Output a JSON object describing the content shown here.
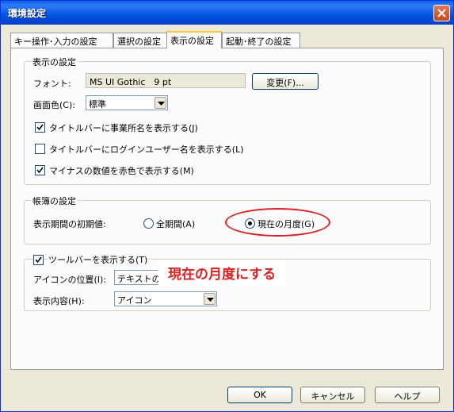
{
  "window": {
    "title": "環境設定"
  },
  "tabs": [
    {
      "label": "キー操作･入力の設定"
    },
    {
      "label": "選択の設定"
    },
    {
      "label": "表示の設定"
    },
    {
      "label": "起動･終了の設定"
    }
  ],
  "active_tab": "表示の設定",
  "display_group": {
    "title": "表示の設定",
    "font_label": "フォント:",
    "font_value": "MS UI Gothic　9 pt",
    "change_button": "変更(F)...",
    "screen_color_label": "画面色(C):",
    "screen_color_value": "標準",
    "checkboxes": [
      {
        "label": "タイトルバーに事業所名を表示する(J)",
        "checked": true
      },
      {
        "label": "タイトルバーにログインユーザー名を表示する(L)",
        "checked": false
      },
      {
        "label": "マイナスの数値を赤色で表示する(M)",
        "checked": true
      }
    ]
  },
  "ledger_group": {
    "title": "帳簿の設定",
    "period_label": "表示期間の初期値:",
    "radio_all": "全期間(A)",
    "radio_current": "現在の月度(G)",
    "selected": "現在の月度(G)"
  },
  "toolbar_group": {
    "checkbox_label": "ツールバーを表示する(T)",
    "checked": true,
    "icon_position_label": "アイコンの位置(I):",
    "icon_position_value": "テキストの",
    "content_label": "表示内容(H):",
    "content_value": "アイコン"
  },
  "annotation": {
    "text": "現在の月度にする"
  },
  "footer": {
    "ok": "OK",
    "cancel": "キャンセル",
    "help": "ヘルプ"
  },
  "colors": {
    "annotation": "#e01f1f",
    "titlebar": "#0054e3",
    "dialog_bg": "#ece9d8"
  }
}
